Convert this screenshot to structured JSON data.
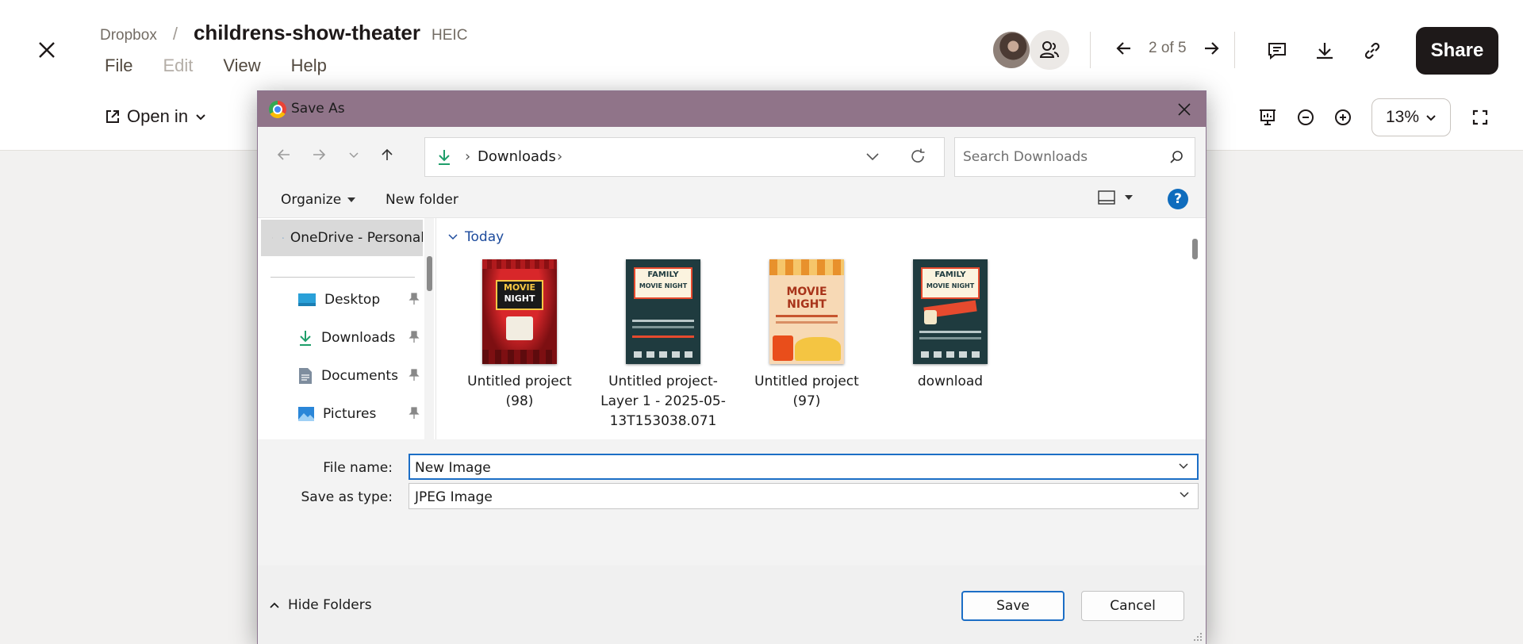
{
  "header": {
    "breadcrumb_root": "Dropbox",
    "breadcrumb_sep": "/",
    "file_title": "childrens-show-theater",
    "file_ext": "HEIC",
    "menu": [
      "File",
      "Edit",
      "View",
      "Help"
    ],
    "open_in_label": "Open in",
    "pager_text": "2 of 5",
    "share_label": "Share",
    "zoom_value": "13%"
  },
  "dialog": {
    "title": "Save As",
    "address_folder": "Downloads",
    "search_placeholder": "Search Downloads",
    "organize_label": "Organize",
    "new_folder_label": "New folder",
    "help_label": "?",
    "nav_pane": {
      "onedrive_label": "OneDrive - Personal",
      "items": [
        "Desktop",
        "Downloads",
        "Documents",
        "Pictures"
      ]
    },
    "group_label": "Today",
    "files": [
      {
        "name": "Untitled project (98)",
        "poster_line1": "MOVIE",
        "poster_line2": "NIGHT"
      },
      {
        "name": "Untitled project-Layer 1 - 2025-05-13T153038.071",
        "poster_line1": "FAMILY",
        "poster_line2": "MOVIE NIGHT"
      },
      {
        "name": "Untitled project (97)",
        "poster_line1": "MOVIE",
        "poster_line2": "NIGHT"
      },
      {
        "name": "download",
        "poster_line1": "FAMILY",
        "poster_line2": "MOVIE NIGHT"
      }
    ],
    "file_name_label": "File name:",
    "file_name_value": "New Image",
    "save_type_label": "Save as type:",
    "save_type_value": "JPEG Image",
    "hide_folders_label": "Hide Folders",
    "save_label": "Save",
    "cancel_label": "Cancel"
  },
  "colors": {
    "titlebar": "#907489",
    "accent": "#1c6ec6",
    "share_bg": "#1e1919"
  }
}
